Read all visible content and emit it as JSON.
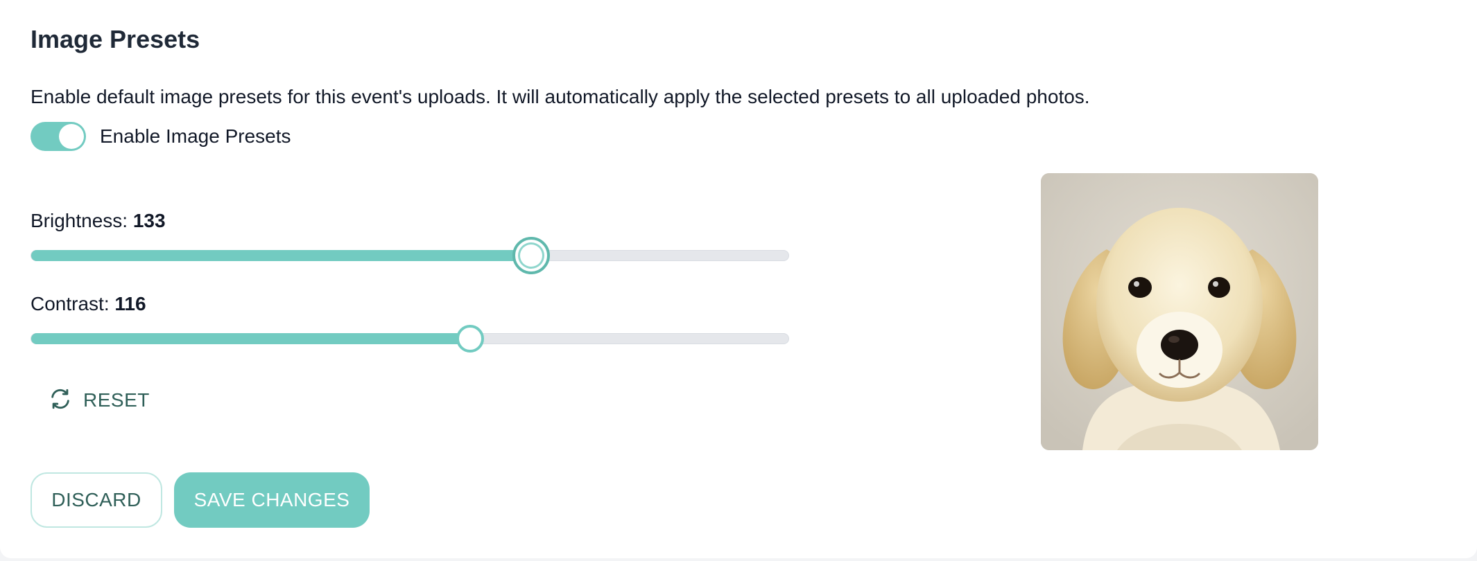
{
  "header": {
    "title": "Image Presets",
    "description": "Enable default image presets for this event's uploads. It will automatically apply the selected presets to all uploaded photos."
  },
  "toggle": {
    "label": "Enable Image Presets",
    "enabled": true
  },
  "sliders": {
    "brightness": {
      "label": "Brightness:",
      "value": "133",
      "fill_percent": 66
    },
    "contrast": {
      "label": "Contrast:",
      "value": "116",
      "fill_percent": 58
    }
  },
  "reset": {
    "label": "RESET",
    "icon": "refresh-icon"
  },
  "buttons": {
    "discard": "DISCARD",
    "save": "SAVE CHANGES"
  },
  "preview": {
    "subject": "golden retriever puppy photo"
  },
  "colors": {
    "accent": "#72cbc1",
    "accent_dark": "#2f5f58",
    "track": "#e5e7eb"
  }
}
